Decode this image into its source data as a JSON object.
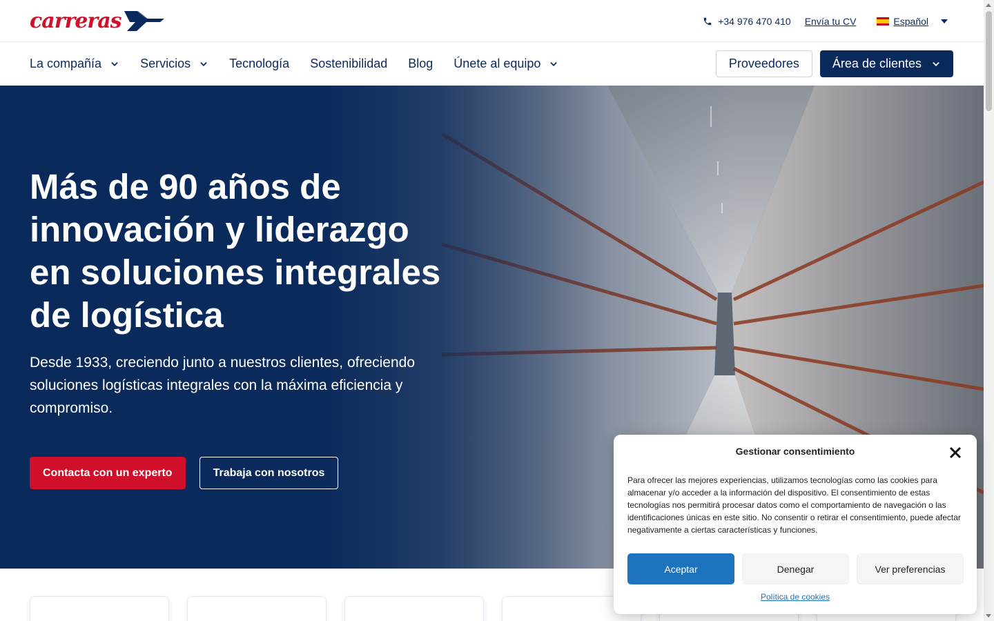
{
  "header": {
    "logo_text": "carreras",
    "phone": "+34 976 470 410",
    "cv_link": "Envía tu CV",
    "language": "Español"
  },
  "nav": {
    "items": [
      {
        "label": "La compañía",
        "has_dropdown": true
      },
      {
        "label": "Servicios",
        "has_dropdown": true
      },
      {
        "label": "Tecnología",
        "has_dropdown": false
      },
      {
        "label": "Sostenibilidad",
        "has_dropdown": false
      },
      {
        "label": "Blog",
        "has_dropdown": false
      },
      {
        "label": "Únete al equipo",
        "has_dropdown": true
      }
    ],
    "suppliers_button": "Proveedores",
    "clients_button": "Área de clientes"
  },
  "hero": {
    "title": "Más de 90 años de innovación y liderazgo en soluciones integrales de logística",
    "subtitle": "Desde 1933, creciendo junto a nuestros clientes, ofreciendo soluciones logísticas integrales con la máxima eficiencia y compromiso.",
    "primary_cta": "Contacta con un experto",
    "secondary_cta": "Trabaja con nosotros"
  },
  "consent": {
    "title": "Gestionar consentimiento",
    "text": "Para ofrecer las mejores experiencias, utilizamos tecnologías como las cookies para almacenar y/o acceder a la información del dispositivo. El consentimiento de estas tecnologías nos permitirá procesar datos como el comportamiento de navegación o las identificaciones únicas en este sitio. No consentir o retirar el consentimiento, puede afectar negativamente a ciertas características y funciones.",
    "accept": "Aceptar",
    "deny": "Denegar",
    "preferences": "Ver preferencias",
    "policy_link": "Política de cookies"
  },
  "colors": {
    "brand_navy": "#0a2a5c",
    "brand_red": "#d0102a",
    "accept_blue": "#1e73be"
  },
  "icons": [
    "phone-icon",
    "spain-flag-icon",
    "chevron-down-icon",
    "close-icon"
  ]
}
